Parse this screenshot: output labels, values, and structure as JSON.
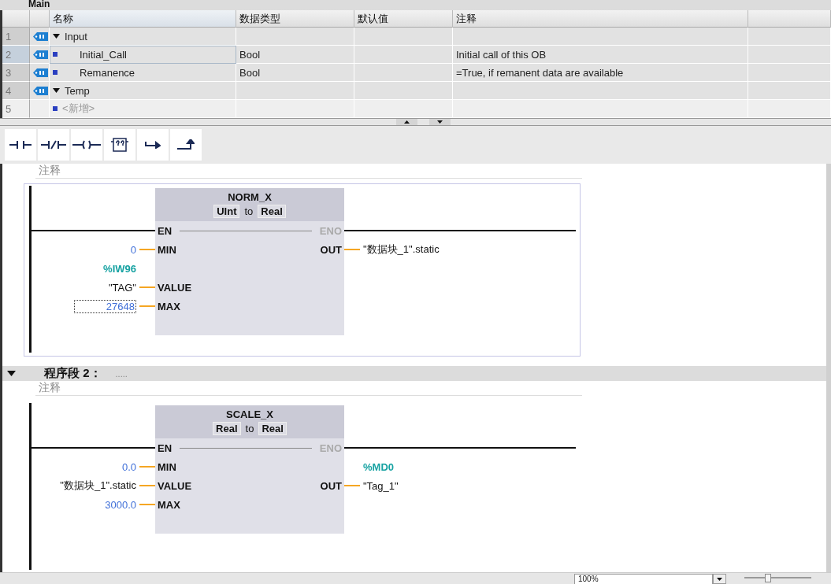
{
  "block_title": "Main",
  "interface_table": {
    "columns": [
      "名称",
      "数据类型",
      "默认值",
      "注释"
    ],
    "rows": [
      {
        "index": "1",
        "kind": "section",
        "expanded": true,
        "selected": false,
        "name": "Input"
      },
      {
        "index": "2",
        "kind": "member",
        "selected": true,
        "name": "Initial_Call",
        "data_type": "Bool",
        "comment": "Initial call of this OB"
      },
      {
        "index": "3",
        "kind": "member",
        "selected": false,
        "name": "Remanence",
        "data_type": "Bool",
        "comment": "=True, if remanent data are available"
      },
      {
        "index": "4",
        "kind": "section",
        "expanded": true,
        "selected": false,
        "name": "Temp"
      },
      {
        "index": "5",
        "kind": "add",
        "selected": false,
        "name": "<新增>"
      }
    ]
  },
  "toolbar": [
    {
      "kind": "contact"
    },
    {
      "kind": "negated-contact"
    },
    {
      "kind": "coil"
    },
    {
      "kind": "empty-box"
    },
    {
      "kind": "open-branch"
    },
    {
      "kind": "close-branch"
    }
  ],
  "networks": [
    {
      "selected": true,
      "comment_placeholder": "注释",
      "box": {
        "name": "NORM_X",
        "in_type": "UInt",
        "connector": "to",
        "out_type": "Real",
        "en": "EN",
        "eno": "ENO",
        "inputs": [
          {
            "pin": "MIN",
            "value": "0",
            "kind": "constant",
            "selected": false
          },
          {
            "pin": "VALUE",
            "address": "%IW96",
            "value": "\"TAG\"",
            "kind": "tag",
            "selected": false
          },
          {
            "pin": "MAX",
            "value": "27648",
            "kind": "constant",
            "selected": true
          }
        ],
        "output": {
          "pin": "OUT",
          "value": "\"数据块_1\".static",
          "kind": "tag"
        }
      }
    },
    {
      "selected": false,
      "title": "程序段 2：",
      "dots": ".....",
      "expanded": true,
      "comment_placeholder": "注释",
      "box": {
        "name": "SCALE_X",
        "in_type": "Real",
        "connector": "to",
        "out_type": "Real",
        "en": "EN",
        "eno": "ENO",
        "inputs": [
          {
            "pin": "MIN",
            "value": "0.0",
            "kind": "constant",
            "selected": false
          },
          {
            "pin": "VALUE",
            "value": "\"数据块_1\".static",
            "kind": "tag",
            "selected": false
          },
          {
            "pin": "MAX",
            "value": "3000.0",
            "kind": "constant",
            "selected": false
          }
        ],
        "output": {
          "pin": "OUT",
          "address": "%MD0",
          "value": "\"Tag_1\"",
          "kind": "tag"
        }
      }
    }
  ],
  "status_bar": {
    "zoom": "100%",
    "zoom_slider": {
      "level": 0.35
    }
  }
}
